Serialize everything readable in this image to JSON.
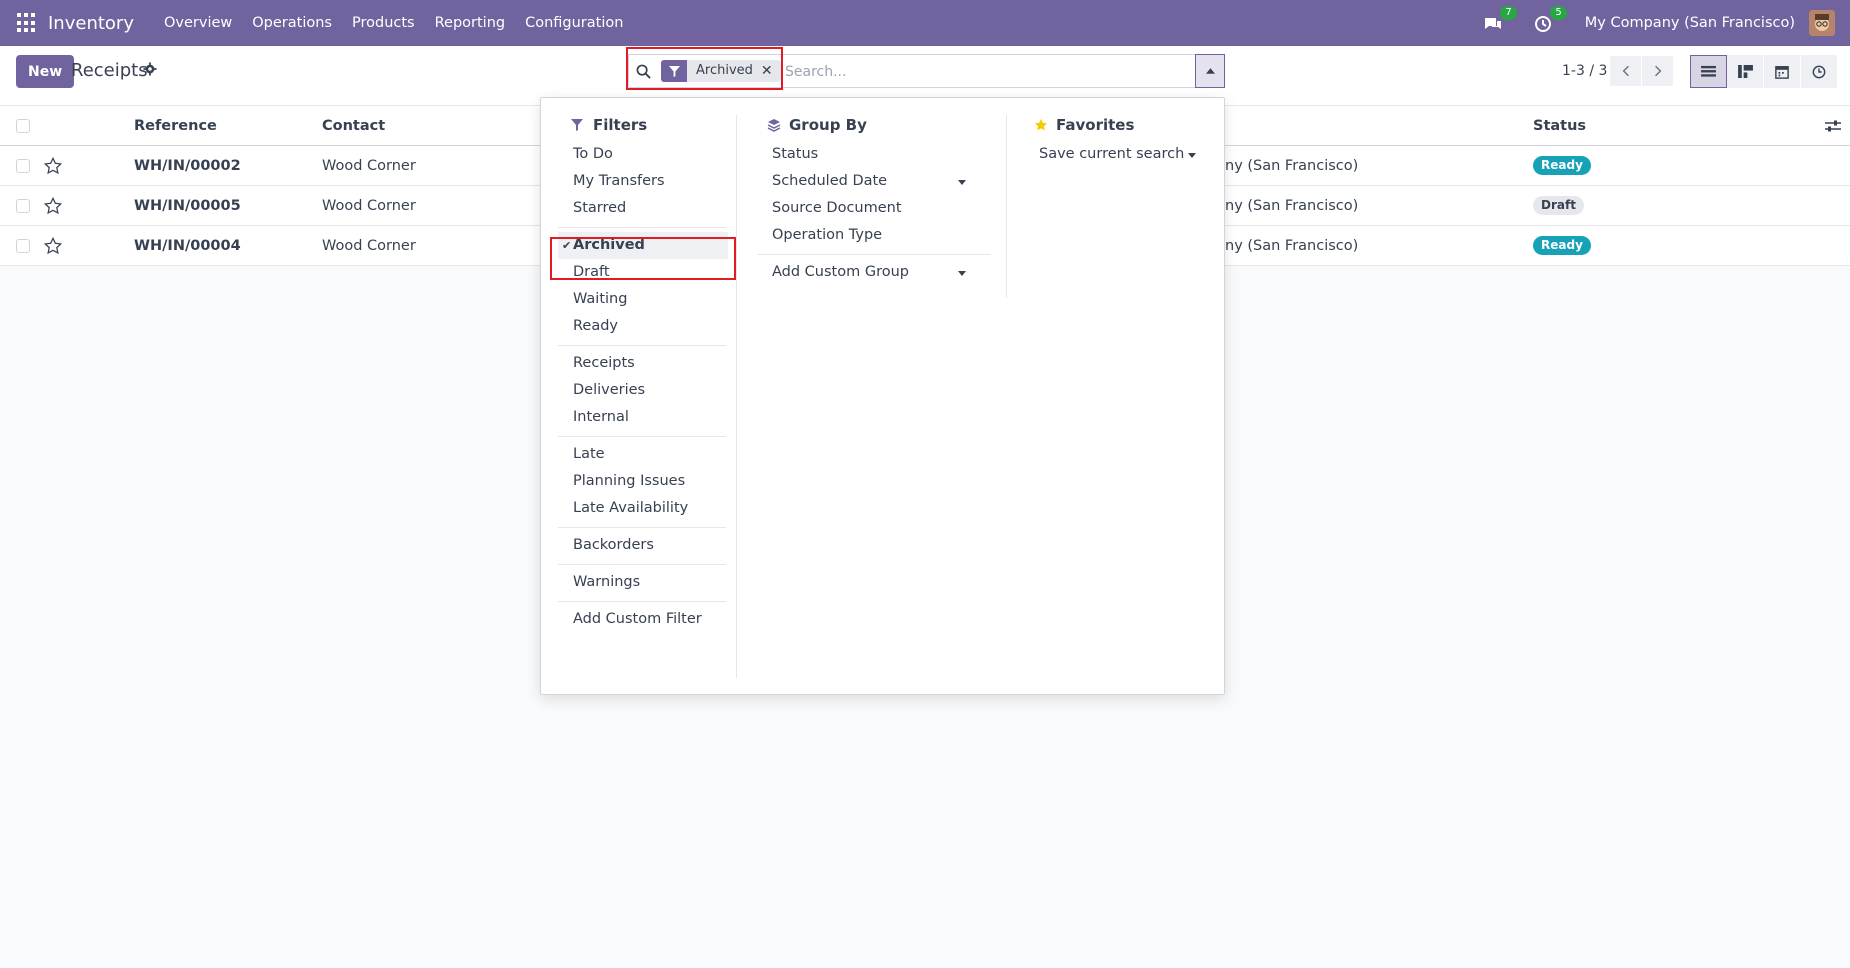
{
  "navbar": {
    "app_name": "Inventory",
    "menu": [
      "Overview",
      "Operations",
      "Products",
      "Reporting",
      "Configuration"
    ],
    "messages_count": "7",
    "activities_count": "5",
    "company": "My Company (San Francisco)"
  },
  "control_panel": {
    "new_label": "New",
    "title": "Receipts",
    "facet_label": "Archived",
    "search_placeholder": "Search...",
    "pager": "1-3 / 3"
  },
  "list": {
    "columns": [
      "Reference",
      "Contact",
      "Status"
    ],
    "rows": [
      {
        "reference": "WH/IN/00002",
        "contact": "Wood Corner",
        "company_fragment": "ny (San Francisco)",
        "status": "Ready"
      },
      {
        "reference": "WH/IN/00005",
        "contact": "Wood Corner",
        "company_fragment": "ny (San Francisco)",
        "status": "Draft"
      },
      {
        "reference": "WH/IN/00004",
        "contact": "Wood Corner",
        "company_fragment": "ny (San Francisco)",
        "status": "Ready"
      }
    ]
  },
  "dropdown": {
    "filters_title": "Filters",
    "filters": {
      "group1": [
        "To Do",
        "My Transfers",
        "Starred"
      ],
      "group2": [
        "Archived",
        "Draft",
        "Waiting",
        "Ready"
      ],
      "group3": [
        "Receipts",
        "Deliveries",
        "Internal"
      ],
      "group4": [
        "Late",
        "Planning Issues",
        "Late Availability"
      ],
      "group5": [
        "Backorders"
      ],
      "group6": [
        "Warnings"
      ],
      "add_custom": "Add Custom Filter"
    },
    "groupby_title": "Group By",
    "groupby": [
      "Status",
      "Scheduled Date",
      "Source Document",
      "Operation Type"
    ],
    "add_custom_group": "Add Custom Group",
    "favorites_title": "Favorites",
    "save_search": "Save current search"
  },
  "colors": {
    "brand": "#71639e",
    "ready": "#17a2b8",
    "highlight": "#e01b24"
  }
}
